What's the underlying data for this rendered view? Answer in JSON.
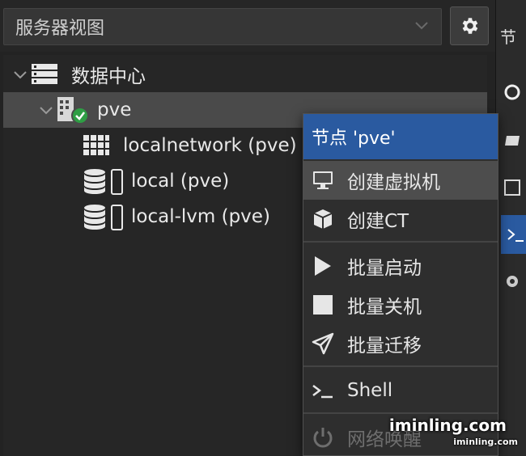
{
  "toolbar": {
    "view_selector": "服务器视图",
    "settings_icon": "gear-icon"
  },
  "tree": {
    "datacenter": {
      "label": "数据中心",
      "icon": "server-rack-icon"
    },
    "node": {
      "label": "pve",
      "icon": "node-online-icon",
      "status": "online"
    },
    "children": [
      {
        "label": "localnetwork (pve)",
        "icon": "sdn-grid-icon"
      },
      {
        "label": "local (pve)",
        "icon": "storage-icon"
      },
      {
        "label": "local-lvm (pve)",
        "icon": "storage-icon"
      }
    ]
  },
  "right_strip": {
    "header_text": "节"
  },
  "context_menu": {
    "title": "节点 'pve'",
    "items": [
      {
        "label": "创建虚拟机",
        "icon": "desktop-icon",
        "state": "hover"
      },
      {
        "label": "创建CT",
        "icon": "cube-icon"
      },
      {
        "label": "批量启动",
        "icon": "play-icon"
      },
      {
        "label": "批量关机",
        "icon": "stop-icon"
      },
      {
        "label": "批量迁移",
        "icon": "paper-plane-icon"
      },
      {
        "label": "Shell",
        "icon": "terminal-icon"
      },
      {
        "label": "网络唤醒",
        "icon": "power-icon",
        "state": "disabled"
      }
    ]
  },
  "watermark": {
    "main": "iminling.com",
    "sub": "iminling.com"
  },
  "colors": {
    "accent": "#2a5aa0",
    "panel": "#262626",
    "selected": "#4a4a4a",
    "hover": "#4d4d4d",
    "online": "#2e9e44"
  }
}
